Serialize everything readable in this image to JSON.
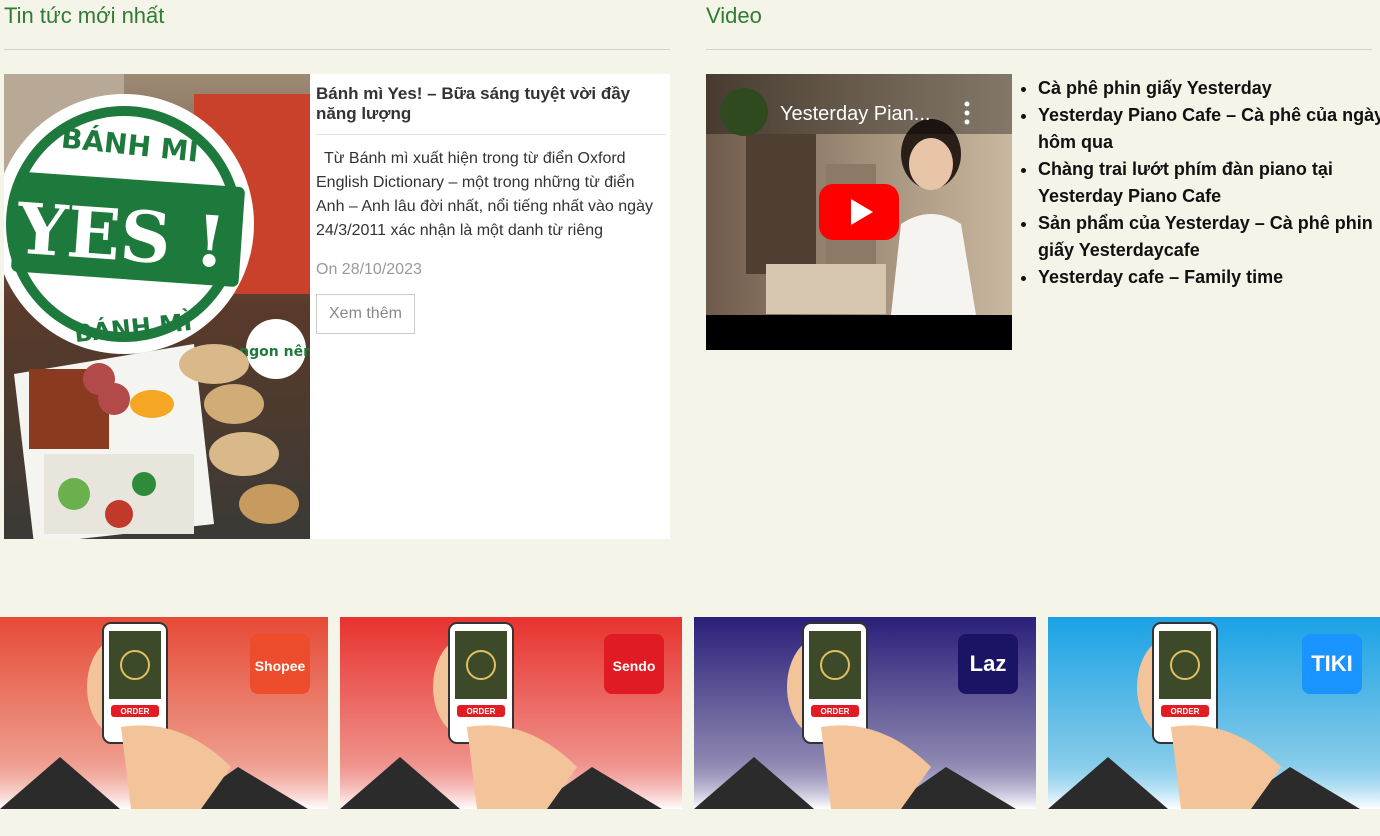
{
  "news": {
    "heading": "Tin tức mới nhất",
    "article": {
      "title": "Bánh mì Yes! – Bữa sáng tuyệt vời đầy năng lượng",
      "excerpt": "Từ Bánh mì xuất hiện trong từ điển Oxford English Dictionary – một trong những từ điển Anh – Anh lâu đời nhất, nổi tiếng nhất vào ngày 24/3/2011 xác nhận là một danh từ riêng",
      "date": "On 28/10/2023",
      "more_label": "Xem thêm",
      "image_sign_top": "BÁNH MÌ",
      "image_sign_main": "YES !",
      "image_sign_bottom": "BÁNH MÌ",
      "image_sticker": "mì ngon nêng"
    }
  },
  "video": {
    "heading": "Video",
    "player_title": "Yesterday Pian...",
    "items": [
      "Cà phê phin giấy Yesterday",
      "Yesterday Piano Cafe – Cà phê của ngày hôm qua",
      "Chàng trai lướt phím đàn piano tại Yesterday Piano Cafe",
      "Sản phẩm của Yesterday – Cà phê phin giấy Yesterdaycafe",
      "Yesterday cafe – Family time"
    ]
  },
  "banners": [
    {
      "platform": "Shopee",
      "logo_text": "Shopee",
      "order_label": "ORDER",
      "bg_top": "#e64a36",
      "bg_bottom": "#ffffff",
      "logo_bg": "#ee4d2d"
    },
    {
      "platform": "Sendo",
      "logo_text": "Sendo",
      "order_label": "ORDER",
      "bg_top": "#e8322f",
      "bg_bottom": "#ffffff",
      "logo_bg": "#e11b23"
    },
    {
      "platform": "Lazada",
      "logo_text": "Laz",
      "order_label": "ORDER",
      "bg_top": "#2a1f7a",
      "bg_bottom": "#ffffff",
      "logo_bg": "#1b1464"
    },
    {
      "platform": "Tiki",
      "logo_text": "TIKI",
      "order_label": "ORDER",
      "bg_top": "#1aa2e6",
      "bg_bottom": "#ffffff",
      "logo_bg": "#1a94ff"
    }
  ]
}
